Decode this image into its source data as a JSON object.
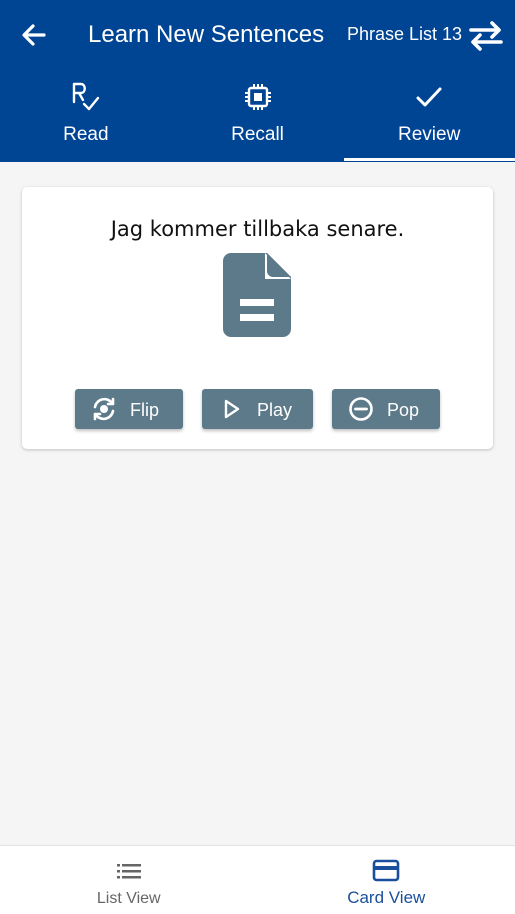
{
  "header": {
    "title": "Learn New Sentences",
    "phrase_list": "Phrase List 13",
    "back_icon": "arrow-left-icon",
    "swap_icon": "swap-arrows-icon"
  },
  "tabs": [
    {
      "label": "Read",
      "icon": "prescription-check-icon",
      "active": false
    },
    {
      "label": "Recall",
      "icon": "chip-icon",
      "active": false
    },
    {
      "label": "Review",
      "icon": "checkmark-icon",
      "active": true
    }
  ],
  "card": {
    "sentence": "Jag kommer tillbaka senare.",
    "icon": "document-icon",
    "buttons": [
      {
        "label": "Flip",
        "icon": "flip-camera-icon"
      },
      {
        "label": "Play",
        "icon": "play-icon"
      },
      {
        "label": "Pop",
        "icon": "minus-circle-icon"
      }
    ]
  },
  "bottom_nav": [
    {
      "label": "List View",
      "icon": "list-icon",
      "active": false
    },
    {
      "label": "Card View",
      "icon": "card-icon",
      "active": true
    }
  ],
  "colors": {
    "primary": "#004494",
    "button": "#5d7a8a",
    "active_nav": "#1a4f9c",
    "background": "#f5f5f5"
  }
}
